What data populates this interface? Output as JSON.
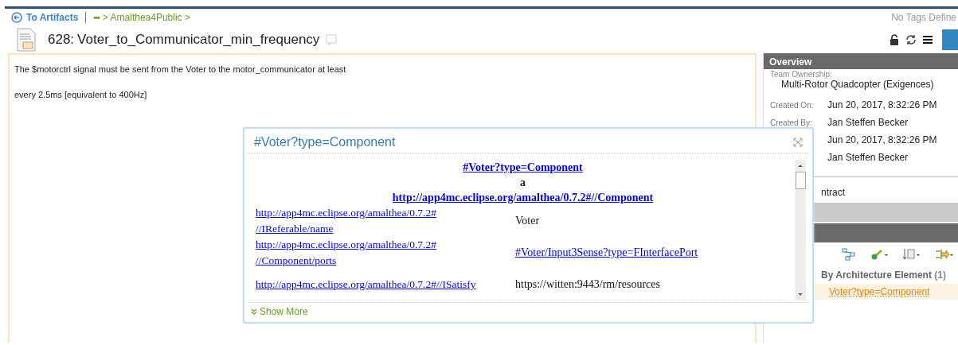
{
  "breadcrumb": {
    "back": "To Artifacts",
    "ellipsis": "•••",
    "path": "> Amalthea4Public >"
  },
  "tags": "No Tags Define",
  "artifact": {
    "id": "628:",
    "title": "Voter_to_Communicator_min_frequency"
  },
  "body": [
    "The $motorctrl signal must be sent from the Voter to the motor_communicator at least",
    "every 2.5ms [equivalent to 400Hz]"
  ],
  "overview": {
    "title": "Overview",
    "team_label": "Team Ownership:",
    "team": "Multi-Rotor Quadcopter (Exigences)",
    "fields": [
      {
        "label": "Created On:",
        "value": "Jun 20, 2017, 8:32:26 PM"
      },
      {
        "label": "Created By:",
        "value": "Jan Steffen Becker"
      },
      {
        "value": "Jun 20, 2017, 8:32:26 PM"
      },
      {
        "value": "Jan Steffen Becker"
      }
    ]
  },
  "section_fragment": "ntract",
  "links_group": {
    "heading": "By Architecture Element",
    "count": "(1)",
    "link": "Voter?type=Component"
  },
  "popup": {
    "title": "#Voter?type=Component",
    "subject": "#Voter?type=Component",
    "predicate": "a",
    "type": "http://app4mc.eclipse.org/amalthea/0.7.2#//Component",
    "rows": [
      {
        "property": [
          "http://app4mc.eclipse.org/amalthea/0.7.2#",
          "//IReferable/name"
        ],
        "kind": "text",
        "value": "Voter"
      },
      {
        "property": [
          "http://app4mc.eclipse.org/amalthea/0.7.2#",
          "//Component/ports"
        ],
        "kind": "link",
        "value": "#Voter/Input3Sense?type=FInterfacePort"
      },
      {
        "property": [
          "http://app4mc.eclipse.org/amalthea/0.7.2#//ISatisfy"
        ],
        "kind": "text",
        "value": "https://witten:9443/rm/resources"
      }
    ],
    "show_more": "Show More"
  }
}
